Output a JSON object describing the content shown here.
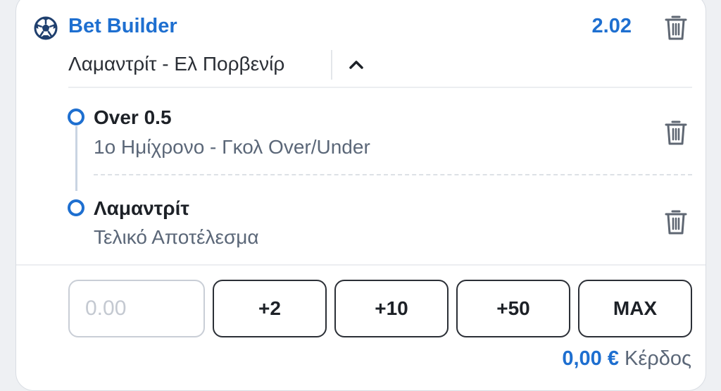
{
  "bet_builder": {
    "title": "Bet Builder",
    "odds": "2.02",
    "match": "Λαμαντρίτ - Ελ Πορβενίρ",
    "icons": {
      "sport": "soccer-ball-icon",
      "delete": "trash-icon",
      "collapse": "chevron-up-icon"
    }
  },
  "selections": [
    {
      "title": "Over 0.5",
      "market": "1ο Ημίχρονο - Γκολ Over/Under"
    },
    {
      "title": "Λαμαντρίτ",
      "market": "Τελικό Αποτέλεσμα"
    }
  ],
  "stake": {
    "placeholder": "0.00",
    "value": ""
  },
  "quick_stakes": [
    "+2",
    "+10",
    "+50",
    "MAX"
  ],
  "profit": {
    "amount": "0,00 €",
    "label": "Κέρδος"
  },
  "colors": {
    "accent": "#1e6fd0",
    "text": "#1d2127",
    "muted": "#5b6778",
    "border": "#2b2f36"
  }
}
